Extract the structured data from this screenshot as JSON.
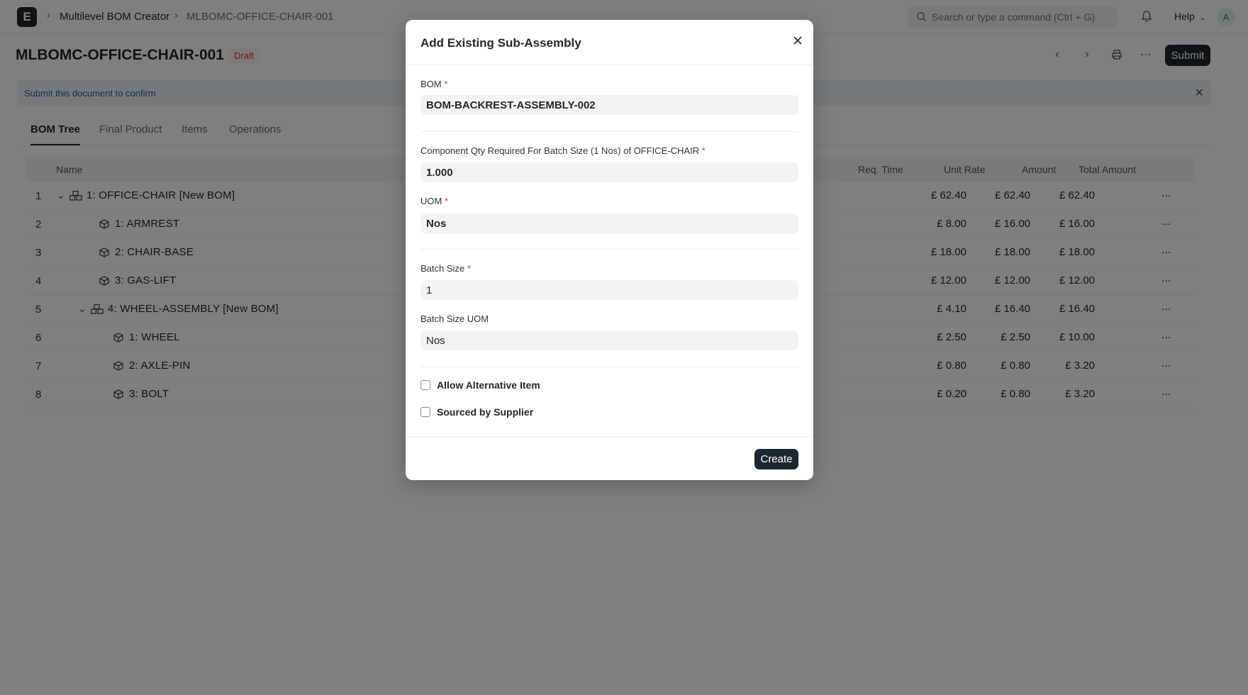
{
  "navbar": {
    "logo": "E",
    "breadcrumb": [
      "Multilevel BOM Creator",
      "MLBOMC-OFFICE-CHAIR-001"
    ],
    "search_placeholder": "Search or type a command (Ctrl + G)",
    "help_label": "Help",
    "avatar_initial": "A"
  },
  "page": {
    "title": "MLBOMC-OFFICE-CHAIR-001",
    "status": "Draft",
    "submit_label": "Submit",
    "banner_text": "Submit this document to confirm"
  },
  "tabs": [
    "BOM Tree",
    "Final Product",
    "Items",
    "Operations"
  ],
  "table": {
    "headers": {
      "name": "Name",
      "req_time": "Req. Time",
      "unit_rate": "Unit Rate",
      "amount": "Amount",
      "total_amount": "Total Amount"
    },
    "rows": [
      {
        "num": "1",
        "name": "1: OFFICE-CHAIR [New BOM]",
        "level": 0,
        "expandable": true,
        "icon": "assembly-icon",
        "unit_rate": "£ 62.40",
        "amount": "£ 62.40",
        "total": "£ 62.40"
      },
      {
        "num": "2",
        "name": "1: ARMREST",
        "level": 1,
        "expandable": false,
        "icon": "item-icon",
        "unit_rate": "£ 8.00",
        "amount": "£ 16.00",
        "total": "£ 16.00"
      },
      {
        "num": "3",
        "name": "2: CHAIR-BASE",
        "level": 1,
        "expandable": false,
        "icon": "item-icon",
        "unit_rate": "£ 18.00",
        "amount": "£ 18.00",
        "total": "£ 18.00"
      },
      {
        "num": "4",
        "name": "3: GAS-LIFT",
        "level": 1,
        "expandable": false,
        "icon": "item-icon",
        "unit_rate": "£ 12.00",
        "amount": "£ 12.00",
        "total": "£ 12.00"
      },
      {
        "num": "5",
        "name": "4: WHEEL-ASSEMBLY [New BOM]",
        "level": 1,
        "expandable": true,
        "icon": "assembly-icon",
        "unit_rate": "£ 4.10",
        "amount": "£ 16.40",
        "total": "£ 16.40"
      },
      {
        "num": "6",
        "name": "1: WHEEL",
        "level": 2,
        "expandable": false,
        "icon": "item-icon",
        "unit_rate": "£ 2.50",
        "amount": "£ 2.50",
        "total": "£ 10.00"
      },
      {
        "num": "7",
        "name": "2: AXLE-PIN",
        "level": 2,
        "expandable": false,
        "icon": "item-icon",
        "unit_rate": "£ 0.80",
        "amount": "£ 0.80",
        "total": "£ 3.20"
      },
      {
        "num": "8",
        "name": "3: BOLT",
        "level": 2,
        "expandable": false,
        "icon": "item-icon",
        "unit_rate": "£ 0.20",
        "amount": "£ 0.80",
        "total": "£ 3.20"
      }
    ],
    "row_menu": "..."
  },
  "modal": {
    "title": "Add Existing Sub-Assembly",
    "bom": {
      "label": "BOM",
      "value": "BOM-BACKREST-ASSEMBLY-002"
    },
    "component_qty": {
      "label": "Component Qty Required For Batch Size (1 Nos) of OFFICE-CHAIR",
      "value": "1.000"
    },
    "uom": {
      "label": "UOM",
      "value": "Nos"
    },
    "batch_size": {
      "label": "Batch Size",
      "value": "1"
    },
    "batch_size_uom": {
      "label": "Batch Size UOM",
      "value": "Nos"
    },
    "allow_alternative": {
      "label": "Allow Alternative Item",
      "checked": false
    },
    "sourced_by_supplier": {
      "label": "Sourced by Supplier",
      "checked": false
    },
    "create_label": "Create",
    "required_mark": "*"
  },
  "colors": {
    "primary": "#1f272e",
    "required": "#e0383e",
    "draft_badge": "#e0383e",
    "banner": "#2a62a8"
  }
}
